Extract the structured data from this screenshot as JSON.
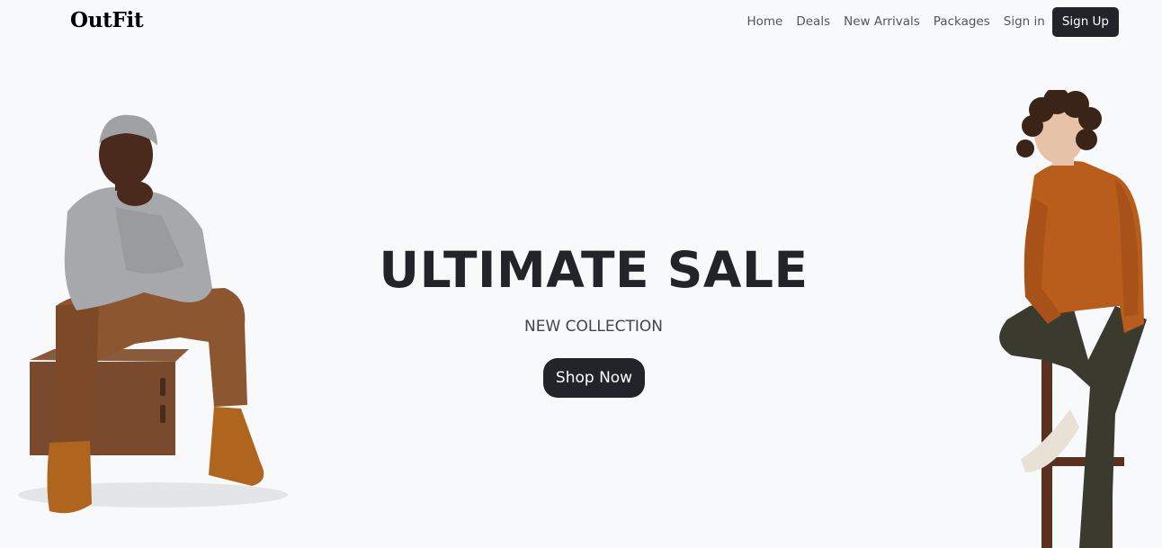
{
  "nav": {
    "brand": "OutFit",
    "links": [
      "Home",
      "Deals",
      "New Arrivals",
      "Packages",
      "Sign in"
    ],
    "signup_label": "Sign Up"
  },
  "hero": {
    "title": "ULTIMATE SALE",
    "subtitle": "NEW COLLECTION",
    "cta_label": "Shop Now"
  },
  "images": {
    "left": "model-seated-on-crate",
    "right": "model-on-bar-stool"
  },
  "colors": {
    "background": "#f8f9fa",
    "dark": "#212529",
    "text_muted": "#555555"
  }
}
